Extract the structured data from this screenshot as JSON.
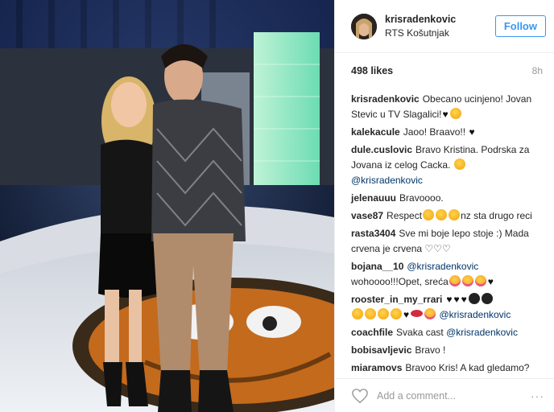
{
  "post": {
    "username": "krisradenkovic",
    "location": "RTS Košutnjak",
    "follow_label": "Follow",
    "likes": "498 likes",
    "time": "8h"
  },
  "comments": [
    {
      "user": "krisradenkovic",
      "text": "Obecano ucinjeno! Jovan Stevic u TV Slagalici!"
    },
    {
      "user": "kalekacule",
      "text": "Jaoo! Braavo!!"
    },
    {
      "user": "dule.cuslovic",
      "text": "Bravo Kristina. Podrska za Jovana iz celog Cacka.",
      "mention": "@krisradenkovic"
    },
    {
      "user": "jelenauuu",
      "text": "Bravoooo."
    },
    {
      "user": "vase87",
      "text": "Respect",
      "text2": "nz sta drugo reci"
    },
    {
      "user": "rasta3404",
      "text": "Sve mi boje lepo stoje :) Mada crvena je crvena ♡♡♡"
    },
    {
      "user": "bojana__10",
      "mention": "@krisradenkovic",
      "text": "wohoooo!!!Opet, sreća"
    },
    {
      "user": "rooster_in_my_rrari",
      "mention": "@krisradenkovic"
    },
    {
      "user": "coachfile",
      "text": "Svaka cast",
      "mention": "@krisradenkovic"
    },
    {
      "user": "bobisavljevic",
      "text": "Bravo !"
    },
    {
      "user": "miaramovs",
      "text": "Bravoo Kris! A kad gledamo?"
    }
  ],
  "footer": {
    "placeholder": "Add a comment...",
    "more": "···"
  },
  "icons": [
    "heart-icon",
    "more-options-icon"
  ],
  "colors": {
    "link": "#003569",
    "follow": "#3897f0",
    "muted": "#999999"
  }
}
